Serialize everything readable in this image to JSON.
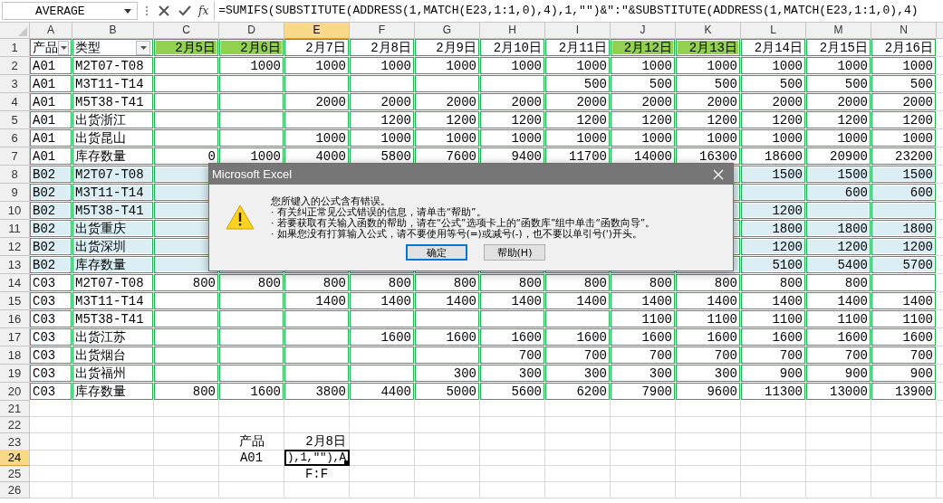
{
  "name_box": "AVERAGE",
  "function_label": "fx",
  "formula": "=SUMIFS(SUBSTITUTE(ADDRESS(1,MATCH(E23,1:1,0),4),1,\"\")&\":\"&SUBSTITUTE(ADDRESS(1,MATCH(E23,1:1,0),4)",
  "columns": [
    {
      "label": "A",
      "selected": false
    },
    {
      "label": "B",
      "selected": false
    },
    {
      "label": "C",
      "selected": false
    },
    {
      "label": "D",
      "selected": false
    },
    {
      "label": "E",
      "selected": true
    },
    {
      "label": "F",
      "selected": false
    },
    {
      "label": "G",
      "selected": false
    },
    {
      "label": "H",
      "selected": false
    },
    {
      "label": "I",
      "selected": false
    },
    {
      "label": "J",
      "selected": false
    },
    {
      "label": "K",
      "selected": false
    },
    {
      "label": "L",
      "selected": false
    },
    {
      "label": "M",
      "selected": false
    },
    {
      "label": "N",
      "selected": false
    }
  ],
  "rows": [
    {
      "label": "1",
      "selected": false,
      "table": true,
      "shaded": false,
      "cells": [
        {
          "text": "产品",
          "kind": "header",
          "filter": true,
          "highlight": false
        },
        {
          "text": "类型",
          "kind": "header",
          "filter": true,
          "highlight": false
        },
        {
          "text": "2月5日",
          "kind": "header",
          "filter": false,
          "highlight": true
        },
        {
          "text": "2月6日",
          "kind": "header",
          "filter": false,
          "highlight": true
        },
        {
          "text": "2月7日",
          "kind": "header",
          "filter": false,
          "highlight": false
        },
        {
          "text": "2月8日",
          "kind": "header",
          "filter": false,
          "highlight": false
        },
        {
          "text": "2月9日",
          "kind": "header",
          "filter": false,
          "highlight": false
        },
        {
          "text": "2月10日",
          "kind": "header",
          "filter": false,
          "highlight": false
        },
        {
          "text": "2月11日",
          "kind": "header",
          "filter": false,
          "highlight": false
        },
        {
          "text": "2月12日",
          "kind": "header",
          "filter": false,
          "highlight": true
        },
        {
          "text": "2月13日",
          "kind": "header",
          "filter": false,
          "highlight": true
        },
        {
          "text": "2月14日",
          "kind": "header",
          "filter": false,
          "highlight": false
        },
        {
          "text": "2月15日",
          "kind": "header",
          "filter": false,
          "highlight": false
        },
        {
          "text": "2月16日",
          "kind": "header",
          "filter": false,
          "highlight": false
        }
      ]
    },
    {
      "label": "2",
      "selected": false,
      "table": true,
      "shaded": false,
      "cells": [
        "A01",
        "M2T07-T08",
        null,
        "1000",
        "1000",
        "1000",
        "1000",
        "1000",
        "1000",
        "1000",
        "1000",
        "1000",
        "1000",
        "1000"
      ]
    },
    {
      "label": "3",
      "selected": false,
      "table": true,
      "shaded": false,
      "cells": [
        "A01",
        "M3T11-T14",
        null,
        null,
        null,
        null,
        null,
        null,
        "500",
        "500",
        "500",
        "500",
        "500",
        "500"
      ]
    },
    {
      "label": "4",
      "selected": false,
      "table": true,
      "shaded": false,
      "cells": [
        "A01",
        "M5T38-T41",
        null,
        null,
        "2000",
        "2000",
        "2000",
        "2000",
        "2000",
        "2000",
        "2000",
        "2000",
        "2000",
        "2000"
      ]
    },
    {
      "label": "5",
      "selected": false,
      "table": true,
      "shaded": false,
      "cells": [
        "A01",
        "出货浙江",
        null,
        null,
        null,
        "1200",
        "1200",
        "1200",
        "1200",
        "1200",
        "1200",
        "1200",
        "1200",
        "1200"
      ]
    },
    {
      "label": "6",
      "selected": false,
      "table": true,
      "shaded": false,
      "cells": [
        "A01",
        "出货昆山",
        null,
        null,
        "1000",
        "1000",
        "1000",
        "1000",
        "1000",
        "1000",
        "1000",
        "1000",
        "1000",
        "1000"
      ]
    },
    {
      "label": "7",
      "selected": false,
      "table": true,
      "shaded": false,
      "cells": [
        "A01",
        "库存数量",
        "0",
        "1000",
        "4000",
        "5800",
        "7600",
        "9400",
        "11700",
        "14000",
        "16300",
        "18600",
        "20900",
        "23200"
      ]
    },
    {
      "label": "8",
      "selected": false,
      "table": true,
      "shaded": true,
      "cells": [
        "B02",
        "M2T07-T08",
        null,
        null,
        null,
        null,
        null,
        null,
        null,
        null,
        null,
        "1500",
        "1500",
        "1500"
      ]
    },
    {
      "label": "9",
      "selected": false,
      "table": true,
      "shaded": true,
      "cells": [
        "B02",
        "M3T11-T14",
        null,
        null,
        null,
        null,
        null,
        null,
        null,
        null,
        null,
        null,
        "600",
        "600"
      ]
    },
    {
      "label": "10",
      "selected": false,
      "table": true,
      "shaded": true,
      "cells": [
        "B02",
        "M5T38-T41",
        null,
        null,
        null,
        null,
        null,
        null,
        null,
        null,
        null,
        "1200",
        null,
        null
      ]
    },
    {
      "label": "11",
      "selected": false,
      "table": true,
      "shaded": true,
      "cells": [
        "B02",
        "出货重庆",
        null,
        null,
        null,
        null,
        null,
        null,
        null,
        null,
        null,
        "1800",
        "1800",
        "1800"
      ]
    },
    {
      "label": "12",
      "selected": false,
      "table": true,
      "shaded": true,
      "cells": [
        "B02",
        "出货深圳",
        null,
        null,
        null,
        null,
        null,
        null,
        null,
        null,
        null,
        "1200",
        "1200",
        "1200"
      ]
    },
    {
      "label": "13",
      "selected": false,
      "table": true,
      "shaded": true,
      "cells": [
        "B02",
        "库存数量",
        null,
        null,
        null,
        null,
        null,
        null,
        null,
        null,
        null,
        "5100",
        "5400",
        "5700"
      ]
    },
    {
      "label": "14",
      "selected": false,
      "table": true,
      "shaded": false,
      "cells": [
        "C03",
        "M2T07-T08",
        "800",
        "800",
        "800",
        "800",
        "800",
        "800",
        "800",
        "800",
        "800",
        "800",
        "800",
        null
      ]
    },
    {
      "label": "15",
      "selected": false,
      "table": true,
      "shaded": false,
      "cells": [
        "C03",
        "M3T11-T14",
        null,
        null,
        "1400",
        "1400",
        "1400",
        "1400",
        "1400",
        "1400",
        "1400",
        "1400",
        "1400",
        "1400"
      ]
    },
    {
      "label": "16",
      "selected": false,
      "table": true,
      "shaded": false,
      "cells": [
        "C03",
        "M5T38-T41",
        null,
        null,
        null,
        null,
        null,
        null,
        null,
        "1100",
        "1100",
        "1100",
        "1100",
        "1100"
      ]
    },
    {
      "label": "17",
      "selected": false,
      "table": true,
      "shaded": false,
      "cells": [
        "C03",
        "出货江苏",
        null,
        null,
        null,
        "1600",
        "1600",
        "1600",
        "1600",
        "1600",
        "1600",
        "1600",
        "1600",
        "1600"
      ]
    },
    {
      "label": "18",
      "selected": false,
      "table": true,
      "shaded": false,
      "cells": [
        "C03",
        "出货烟台",
        null,
        null,
        null,
        null,
        null,
        "700",
        "700",
        "700",
        "700",
        "700",
        "700",
        "700"
      ]
    },
    {
      "label": "19",
      "selected": false,
      "table": true,
      "shaded": false,
      "cells": [
        "C03",
        "出货福州",
        null,
        null,
        null,
        null,
        "300",
        "300",
        "300",
        "300",
        "300",
        "900",
        "900",
        "900"
      ]
    },
    {
      "label": "20",
      "selected": false,
      "table": true,
      "shaded": false,
      "cells": [
        "C03",
        "库存数量",
        "800",
        "1600",
        "3800",
        "4400",
        "5000",
        "5600",
        "6200",
        "7900",
        "9600",
        "11300",
        "13000",
        "13900"
      ]
    },
    {
      "label": "21",
      "selected": false,
      "table": false,
      "shaded": false
    },
    {
      "label": "22",
      "selected": false,
      "table": false,
      "shaded": false
    },
    {
      "label": "23",
      "selected": false,
      "table": false,
      "shaded": false,
      "cells": [
        null,
        null,
        null,
        {
          "text": "产品",
          "kind": "center"
        },
        "2月8日"
      ]
    },
    {
      "label": "24",
      "selected": true,
      "table": false,
      "shaded": false,
      "cells": [
        null,
        null,
        null,
        {
          "text": "A01",
          "kind": "center"
        },
        {
          "text": "),1,\"\"),A",
          "kind": "editing"
        }
      ]
    },
    {
      "label": "25",
      "selected": false,
      "table": false,
      "shaded": false,
      "cells": [
        null,
        null,
        null,
        null,
        {
          "text": "F:F",
          "kind": "center"
        }
      ]
    },
    {
      "label": "26",
      "selected": false,
      "table": false,
      "shaded": false
    }
  ],
  "dialog": {
    "title": "Microsoft Excel",
    "lines": [
      "您所键入的公式含有错误。",
      "· 有关纠正常见公式错误的信息，请单击“帮助”。",
      "· 若要获取有关输入函数的帮助，请在“公式”选项卡上的“函数库”组中单击“函数向导”。",
      "· 如果您没有打算输入公式，请不要使用等号(=)或减号(-)，也不要以单引号(')开头。"
    ],
    "buttons": [
      {
        "label": "确定",
        "default": true
      },
      {
        "label": "帮助(H)",
        "default": false
      }
    ]
  }
}
